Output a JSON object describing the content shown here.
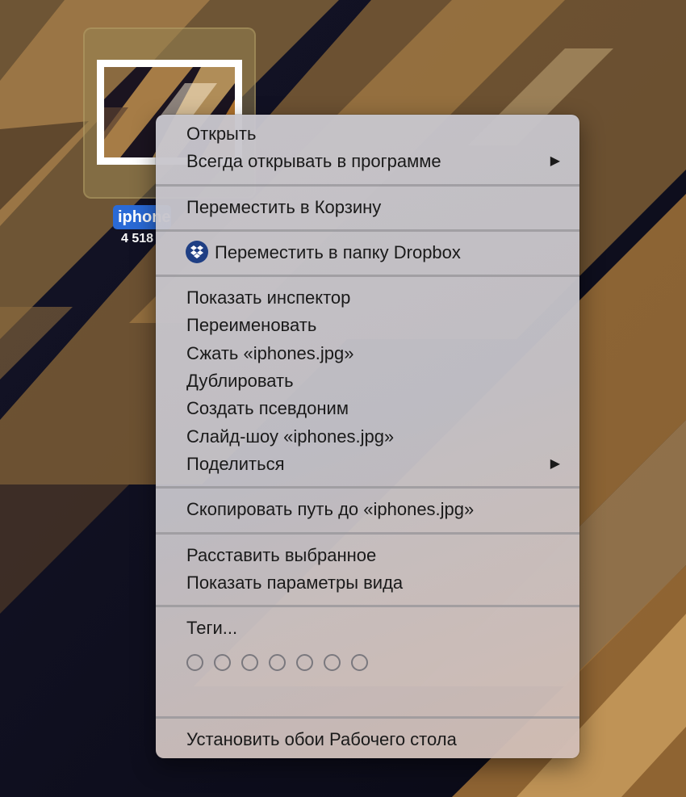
{
  "desktop": {
    "file": {
      "name": "iphones.jpg",
      "size": "4 518 × 3 000"
    }
  },
  "colors": {
    "selection": "#2a6ad6",
    "menu_bg": "#c6c4ca",
    "dropbox": "#1f3f84"
  },
  "menu": {
    "open": "Открыть",
    "open_with": "Всегда открывать в программе",
    "move_to_trash": "Переместить в Корзину",
    "move_to_dropbox": "Переместить в папку Dropbox",
    "show_inspector": "Показать инспектор",
    "rename": "Переименовать",
    "compress": "Сжать «iphones.jpg»",
    "duplicate": "Дублировать",
    "make_alias": "Создать псевдоним",
    "slideshow": "Слайд-шоу «iphones.jpg»",
    "share": "Поделиться",
    "copy_path": "Скопировать путь до «iphones.jpg»",
    "arrange_selection": "Расставить выбранное",
    "show_view_options": "Показать параметры вида",
    "tags": "Теги...",
    "set_wallpaper": "Установить обои Рабочего стола",
    "submenu_arrow": "▶"
  },
  "icons": {
    "dropbox": "dropbox-icon",
    "tag": "tag-circle-icon"
  }
}
